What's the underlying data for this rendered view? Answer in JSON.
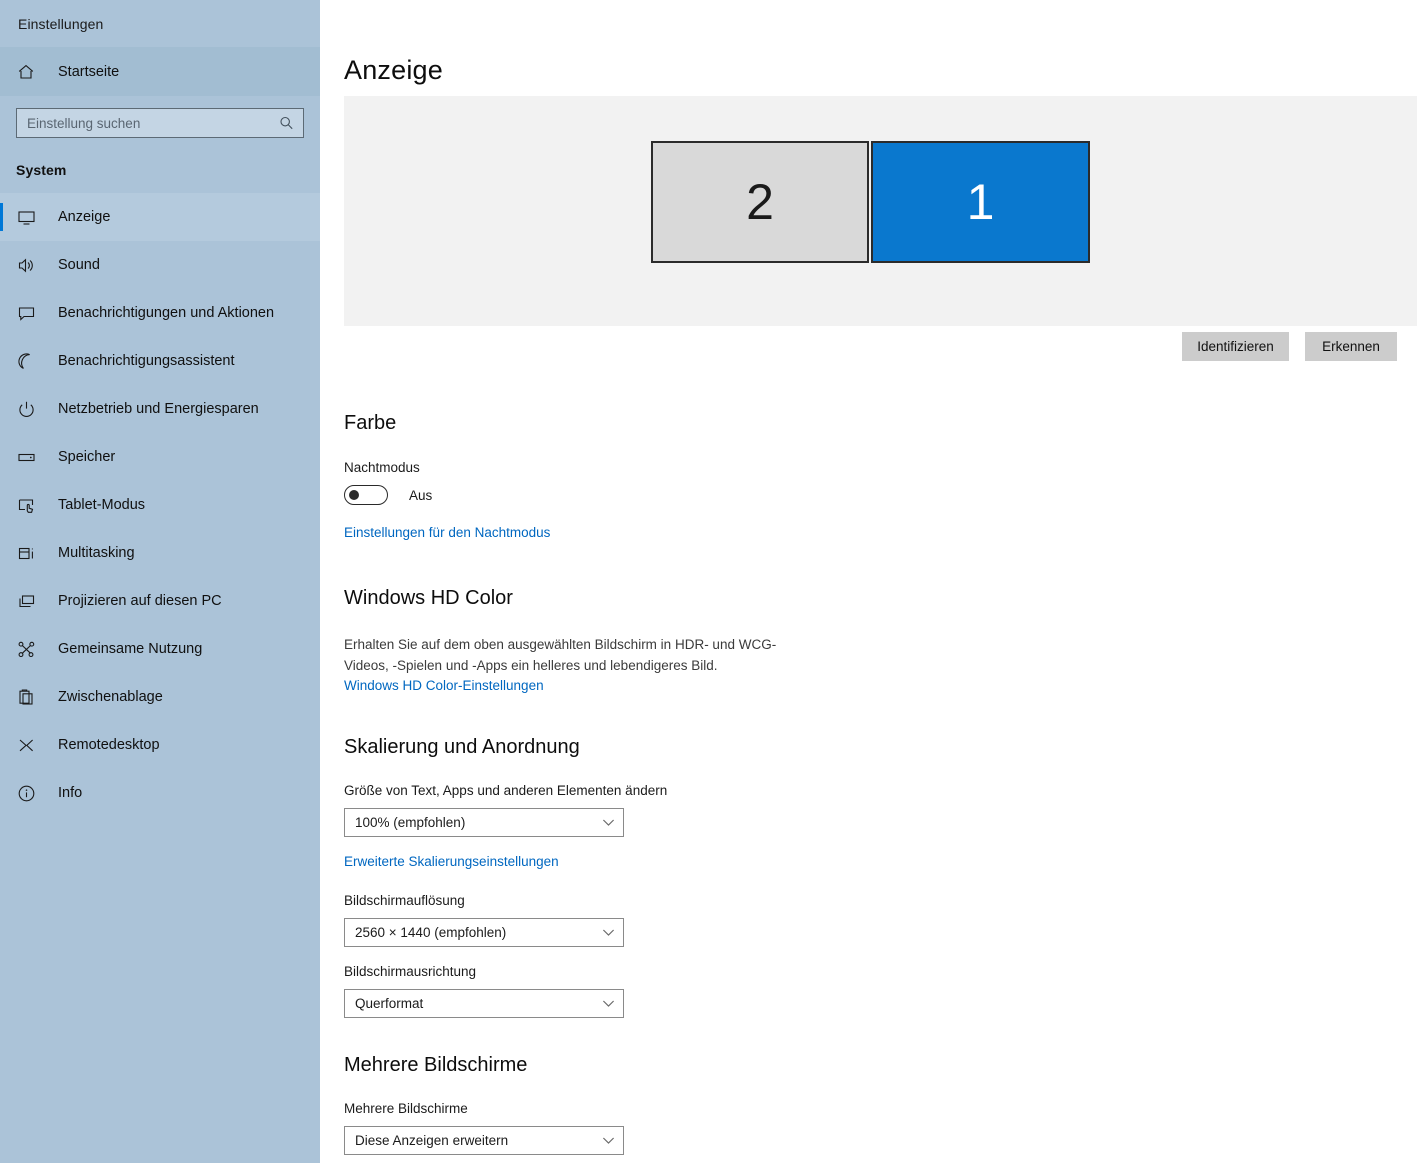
{
  "app": {
    "title": "Einstellungen"
  },
  "sidebar": {
    "home": {
      "label": "Startseite",
      "icon": "home-icon"
    },
    "search": {
      "placeholder": "Einstellung suchen",
      "value": "",
      "icon": "search-icon"
    },
    "group_label": "System",
    "items": [
      {
        "label": "Anzeige",
        "icon": "monitor-icon",
        "active": true
      },
      {
        "label": "Sound",
        "icon": "speaker-icon",
        "active": false
      },
      {
        "label": "Benachrichtigungen und Aktionen",
        "icon": "chat-bubble-icon",
        "active": false
      },
      {
        "label": "Benachrichtigungsassistent",
        "icon": "moon-icon",
        "active": false
      },
      {
        "label": "Netzbetrieb und Energiesparen",
        "icon": "power-icon",
        "active": false
      },
      {
        "label": "Speicher",
        "icon": "drive-icon",
        "active": false
      },
      {
        "label": "Tablet-Modus",
        "icon": "tablet-hand-icon",
        "active": false
      },
      {
        "label": "Multitasking",
        "icon": "multitasking-icon",
        "active": false
      },
      {
        "label": "Projizieren auf diesen PC",
        "icon": "project-screen-icon",
        "active": false
      },
      {
        "label": "Gemeinsame Nutzung",
        "icon": "share-icon",
        "active": false
      },
      {
        "label": "Zwischenablage",
        "icon": "clipboard-icon",
        "active": false
      },
      {
        "label": "Remotedesktop",
        "icon": "remote-desktop-icon",
        "active": false
      },
      {
        "label": "Info",
        "icon": "info-icon",
        "active": false
      }
    ]
  },
  "main": {
    "page_title": "Anzeige",
    "preview": {
      "monitors": [
        {
          "number": "2",
          "selected": false
        },
        {
          "number": "1",
          "selected": true
        }
      ],
      "identify_button": "Identifizieren",
      "detect_button": "Erkennen"
    },
    "color_section": {
      "heading": "Farbe",
      "night_mode_label": "Nachtmodus",
      "night_mode_state": "Aus",
      "night_mode_link": "Einstellungen für den Nachtmodus"
    },
    "hdr_section": {
      "heading": "Windows HD Color",
      "description": "Erhalten Sie auf dem oben ausgewählten Bildschirm in HDR- und WCG-Videos, -Spielen und -Apps ein helleres und lebendigeres Bild.",
      "link": "Windows HD Color-Einstellungen"
    },
    "scale_section": {
      "heading": "Skalierung und Anordnung",
      "scale_label": "Größe von Text, Apps und anderen Elementen ändern",
      "scale_value": "100% (empfohlen)",
      "advanced_link": "Erweiterte Skalierungseinstellungen",
      "resolution_label": "Bildschirmauflösung",
      "resolution_value": "2560 × 1440 (empfohlen)",
      "orientation_label": "Bildschirmausrichtung",
      "orientation_value": "Querformat"
    },
    "multi_section": {
      "heading": "Mehrere Bildschirme",
      "field_label": "Mehrere Bildschirme",
      "field_value": "Diese Anzeigen erweitern"
    }
  },
  "colors": {
    "sidebar_bg": "#abc3d8",
    "accent": "#0078d7",
    "link": "#0067c0",
    "monitor_selected": "#0a78ce",
    "button_bg": "#cccccc"
  }
}
